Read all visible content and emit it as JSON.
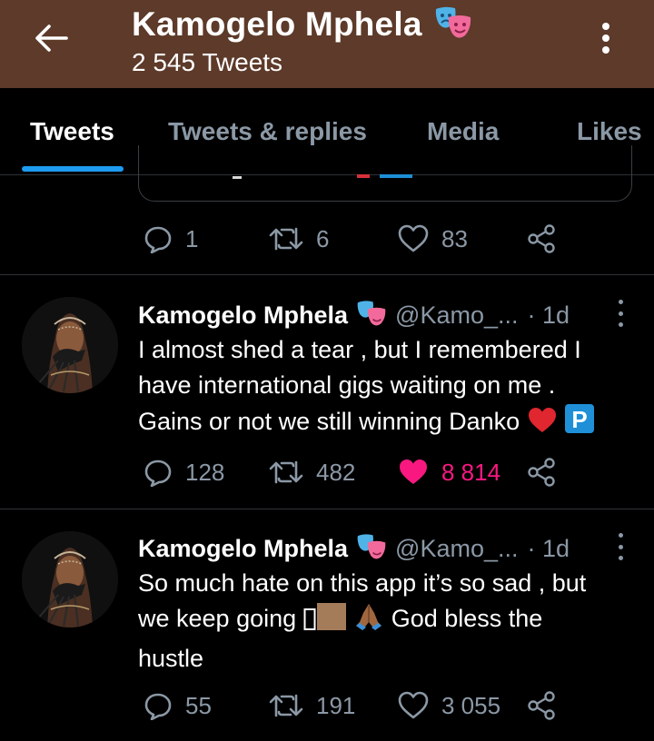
{
  "header": {
    "title": "Kamogelo Mphela",
    "title_emoji_icon": "performing-arts-icon",
    "subtitle": "2 545 Tweets",
    "back_icon": "arrow-left-icon",
    "more_icon": "more-vertical-icon",
    "background": "#5d3a29"
  },
  "tabs": [
    {
      "label": "Tweets",
      "active": true
    },
    {
      "label": "Tweets & replies",
      "active": false
    },
    {
      "label": "Media",
      "active": false
    },
    {
      "label": "Likes",
      "active": false
    }
  ],
  "colors": {
    "accent": "#1d9bf0",
    "like_active": "#f91880",
    "muted": "#8b98a5"
  },
  "first_tweet": {
    "stats": {
      "replies": "1",
      "retweets": "6",
      "likes": "83"
    }
  },
  "tweets": [
    {
      "name": "Kamogelo Mphela",
      "handle": "@Kamo_...",
      "time": "· 1d",
      "text_line1": "I almost shed a tear , but I remembered I",
      "text_line2": "have international gigs waiting on me .",
      "text_line3": "Gains or not we still winning Danko",
      "emojis": [
        "red-heart-icon",
        "p-button-icon"
      ],
      "stats": {
        "replies": "128",
        "retweets": "482",
        "likes": "8 814",
        "liked": true
      }
    },
    {
      "name": "Kamogelo Mphela",
      "handle": "@Kamo_...",
      "time": "· 1d",
      "text_line1": "So much hate on this app it’s so sad , but",
      "text_line2a": "we keep going",
      "text_line2b": "God bless the",
      "text_line3": "hustle",
      "emojis": [
        "missing-glyph-icon",
        "skin-tone-icon",
        "folded-hands-icon"
      ],
      "stats": {
        "replies": "55",
        "retweets": "191",
        "likes": "3 055",
        "liked": false
      }
    }
  ]
}
